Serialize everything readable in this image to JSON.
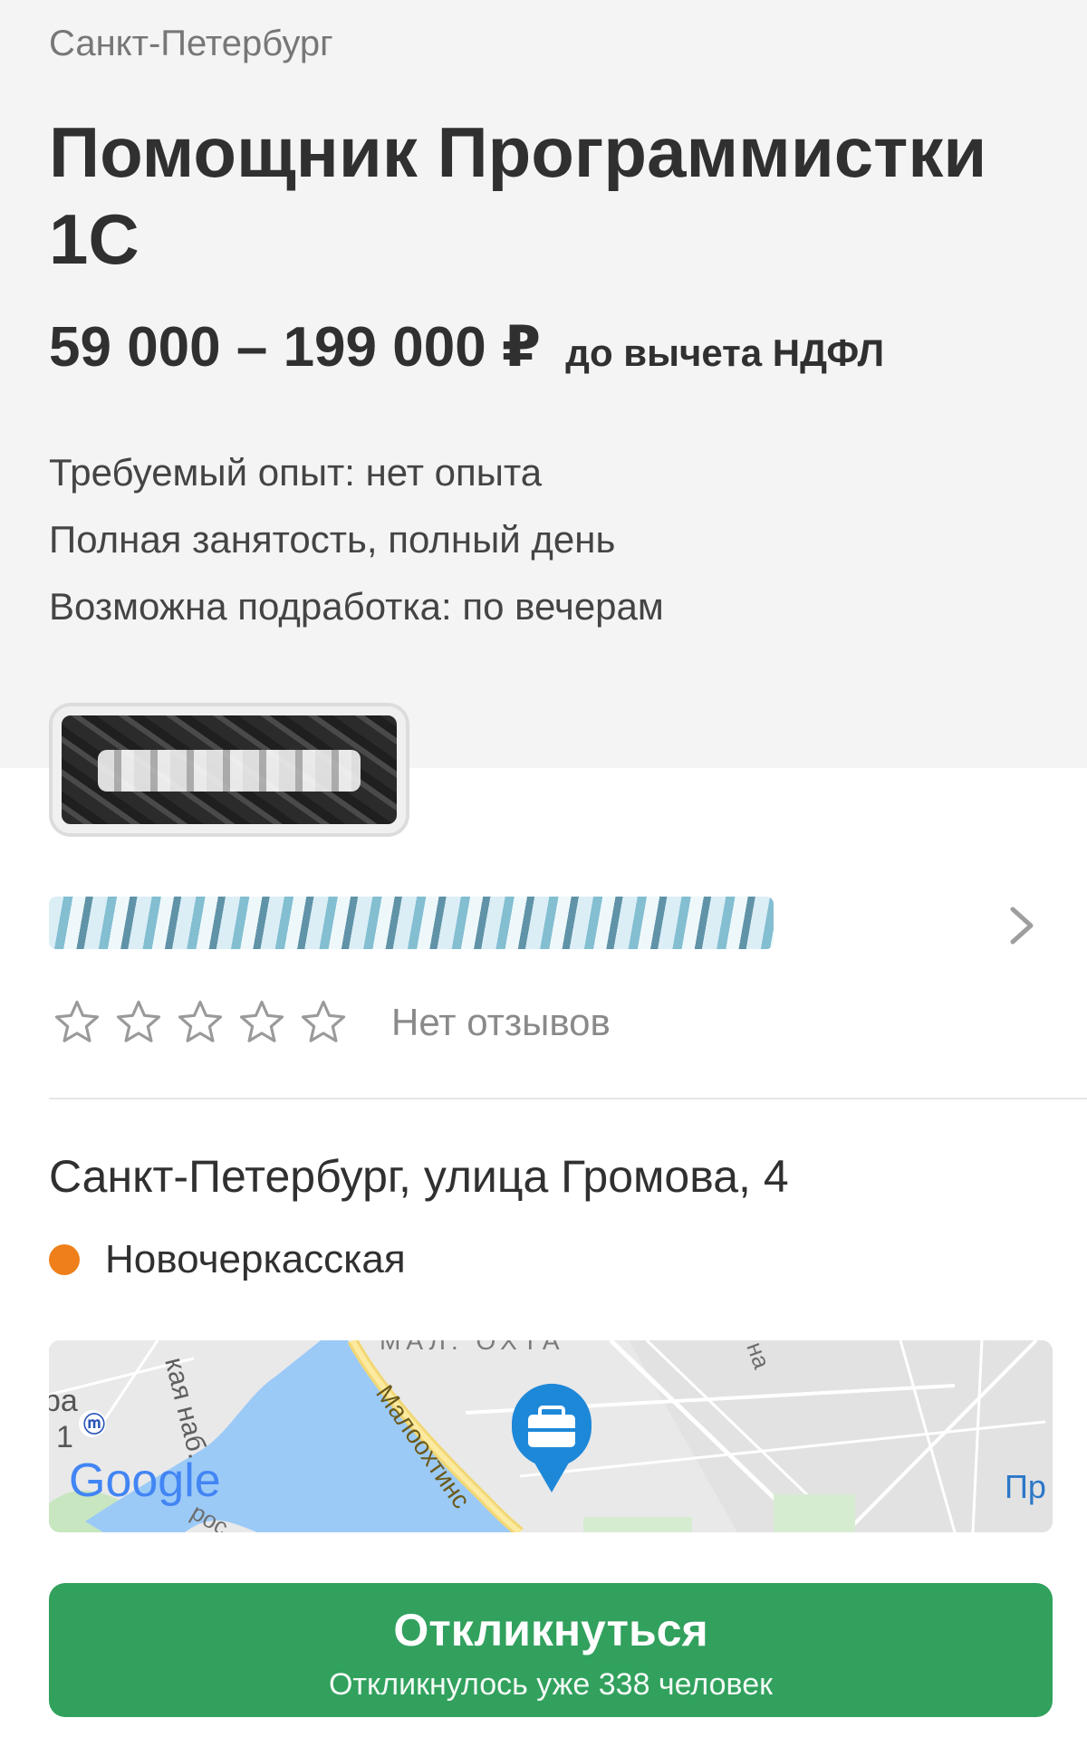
{
  "vacancy": {
    "city": "Санкт-Петербург",
    "title": "Помощник Программистки 1С",
    "salary": "59 000 – 199 000 ₽",
    "salary_note": "до вычета НДФЛ",
    "requirements": [
      "Требуемый опыт: нет опыта",
      "Полная занятость, полный день",
      "Возможна подработка: по вечерам"
    ]
  },
  "employer": {
    "logo_icon": "employer-logo-redacted",
    "name_redacted": true,
    "rating_stars": 5,
    "rating_value": 0,
    "reviews_label": "Нет отзывов"
  },
  "location": {
    "address": "Санкт-Петербург, улица Громова, 4",
    "metro": "Новочеркасская",
    "metro_color": "#ef7f1a"
  },
  "map": {
    "labels": {
      "district": "МАЛ. ОХТА",
      "embankment": "кая наб.",
      "street": "Малоохтинс",
      "google": "Google",
      "partial_left": "ра",
      "partial_digit": "1",
      "partial_right": "Пр",
      "partial_road": "рос",
      "partial_top": "на"
    },
    "marker_icon": "briefcase-pin-icon",
    "marker_color": "#1e88d8",
    "water_color": "#9ccaf7"
  },
  "apply": {
    "label": "Откликнуться",
    "sublabel": "Откликнулось уже 338 человек",
    "color": "#31a15d"
  }
}
